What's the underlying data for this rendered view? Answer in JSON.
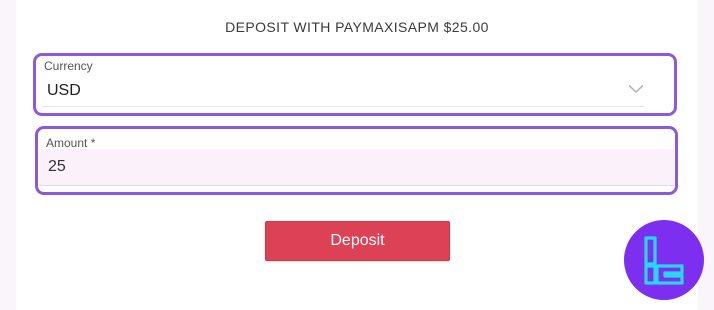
{
  "title": "DEPOSIT WITH PAYMAXISAPM $25.00",
  "currency": {
    "label": "Currency",
    "value": "USD"
  },
  "amount": {
    "label": "Amount *",
    "value": "25"
  },
  "deposit_button": {
    "label": "Deposit"
  },
  "colors": {
    "accent": "#8b59d9",
    "button": "#dd4155",
    "logo_bg": "#7d2ff0",
    "logo_mark": "#27d8f5"
  },
  "icons": {
    "select_arrow": "chevron-down-icon",
    "watermark": "tc-logo-icon"
  }
}
